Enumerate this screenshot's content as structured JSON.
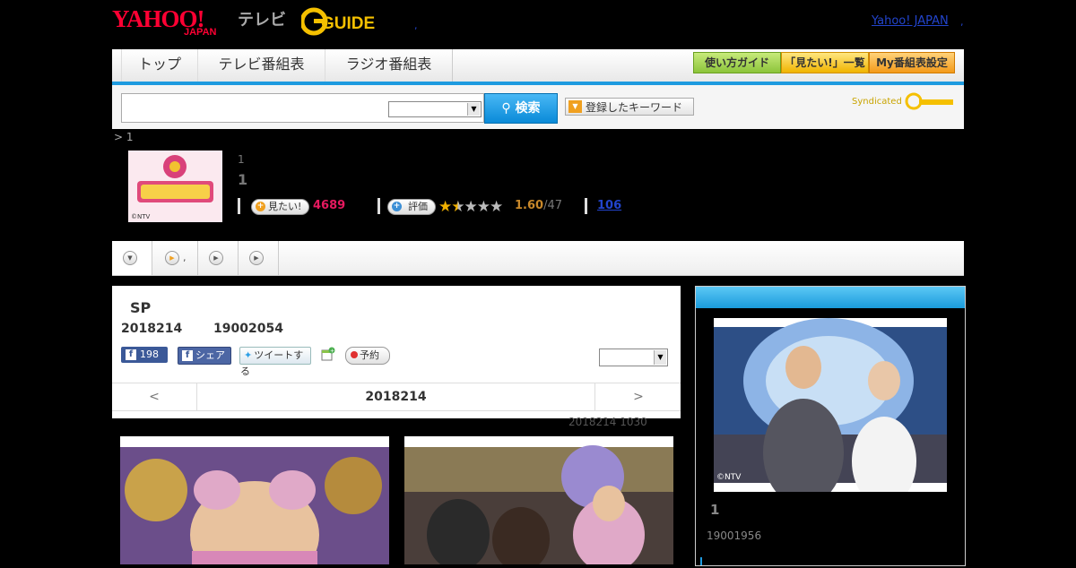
{
  "header": {
    "yahoo_logo": "YAHOO!",
    "japan_logo": "JAPAN",
    "tv_label": "テレビ",
    "gguide_logo": "GUIDE",
    "yahoo_japan_link": "Yahoo! JAPAN",
    "dot1": ",",
    "dot2": ","
  },
  "nav": {
    "tabs": [
      "トップ",
      "テレビ番組表",
      "ラジオ番組表"
    ],
    "buttons": [
      "使い方ガイド",
      "「見たい!」一覧",
      "My番組表設定"
    ]
  },
  "search": {
    "button_label": "検索",
    "keyword_button": "登録したキーワード",
    "syndicated": "Syndicated"
  },
  "breadcrumb": "> 1",
  "program": {
    "thumb_credit": "©NTV",
    "small_title": "1",
    "big_title": "1",
    "want_label": "見たい!",
    "want_count": "4689",
    "rate_label": "評価",
    "rating": "1.60",
    "rating_den": "/47",
    "review_count": "106",
    "stars_filled": 1.6
  },
  "tabs_row": {
    "tab2_suffix": ","
  },
  "episode": {
    "title": "SP",
    "date": "2018214",
    "time": "19002054",
    "fb_count": "198",
    "share_label": "シェア",
    "tweet_label": "ツイートする",
    "reserve_label": "予約",
    "pager_prev": "<",
    "pager_date": "2018214",
    "pager_next": ">",
    "updated": "2018214  1030"
  },
  "side": {
    "img_credit": "©NTV",
    "number": "1",
    "time": "19001956"
  },
  "colors": {
    "accent_blue": "#1e9be0",
    "yahoo_red": "#ff0033",
    "want_pink": "#e6195f",
    "link_blue": "#2244cc"
  }
}
